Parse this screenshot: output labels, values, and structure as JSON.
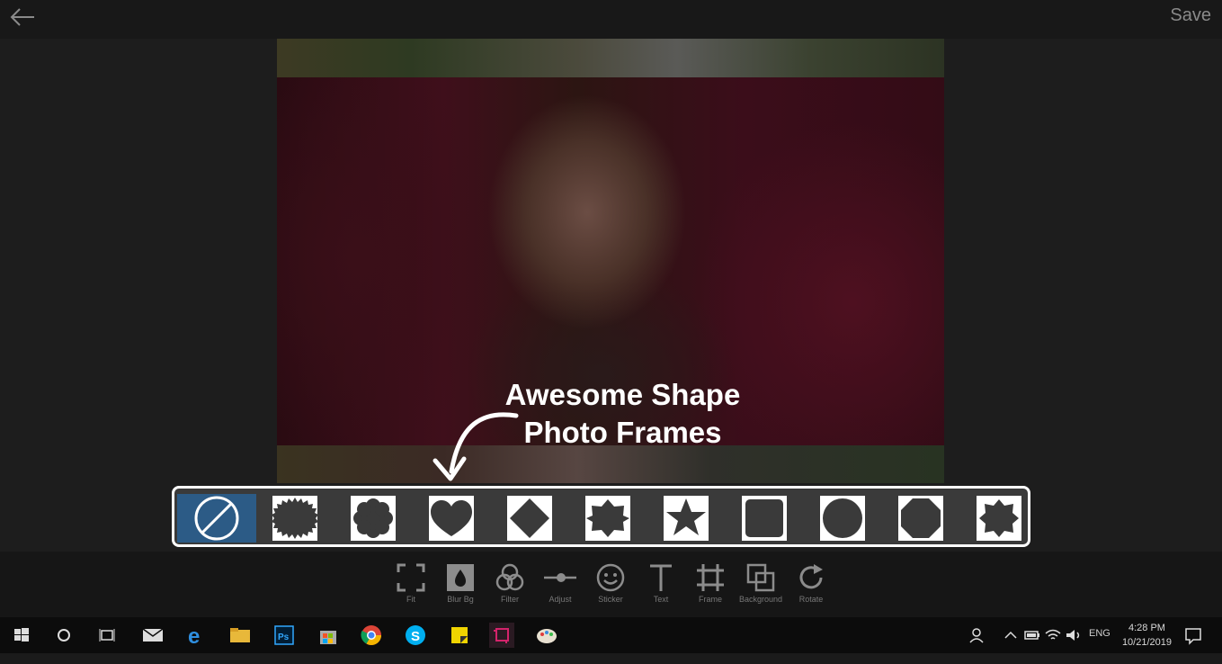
{
  "header": {
    "save_label": "Save",
    "back_icon": "back-arrow-icon"
  },
  "callout": {
    "line1": "Awesome Shape",
    "line2": "Photo Frames"
  },
  "frames": [
    {
      "name": "none",
      "selected": true
    },
    {
      "name": "sawtooth-circle"
    },
    {
      "name": "flower"
    },
    {
      "name": "heart"
    },
    {
      "name": "diamond"
    },
    {
      "name": "octagram"
    },
    {
      "name": "star"
    },
    {
      "name": "rounded-square"
    },
    {
      "name": "circle"
    },
    {
      "name": "octagon"
    },
    {
      "name": "eight-point-star"
    }
  ],
  "toolbar": {
    "items": [
      {
        "label": "Fit",
        "icon": "fit-icon"
      },
      {
        "label": "Blur Bg",
        "icon": "blur-icon"
      },
      {
        "label": "Filter",
        "icon": "filter-icon"
      },
      {
        "label": "Adjust",
        "icon": "adjust-icon"
      },
      {
        "label": "Sticker",
        "icon": "sticker-icon"
      },
      {
        "label": "Text",
        "icon": "text-icon"
      },
      {
        "label": "Frame",
        "icon": "frame-icon"
      },
      {
        "label": "Background",
        "icon": "background-icon"
      },
      {
        "label": "Rotate",
        "icon": "rotate-icon"
      }
    ]
  },
  "taskbar": {
    "language": "ENG",
    "time": "4:28 PM",
    "date": "10/21/2019"
  },
  "colors": {
    "accent": "#2c5b86",
    "panel": "#3a3a3a",
    "background": "#1b1b1b"
  }
}
